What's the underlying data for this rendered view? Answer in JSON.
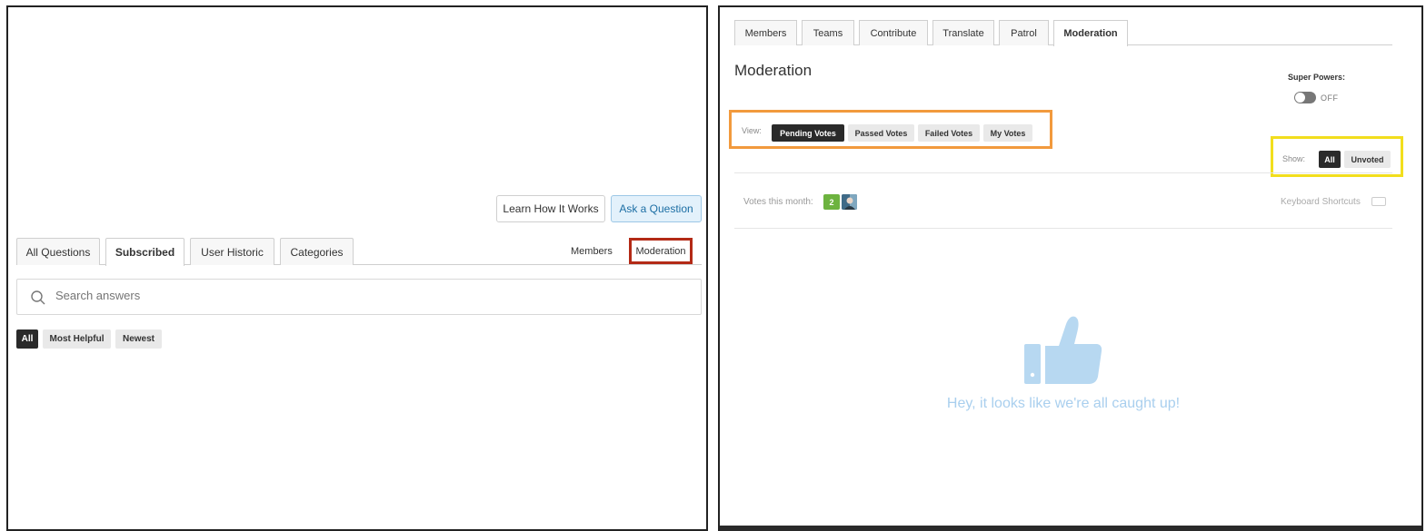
{
  "left": {
    "buttons": {
      "learn": "Learn How It Works",
      "ask": "Ask a Question"
    },
    "tabs": [
      "All Questions",
      "Subscribed",
      "User Historic",
      "Categories"
    ],
    "links": {
      "members": "Members",
      "moderation": "Moderation"
    },
    "search": {
      "placeholder": "Search answers"
    },
    "filters": [
      "All",
      "Most Helpful",
      "Newest"
    ],
    "highlight_color": "#b32a16"
  },
  "right": {
    "tabs": [
      "Members",
      "Teams",
      "Contribute",
      "Translate",
      "Patrol",
      "Moderation"
    ],
    "title": "Moderation",
    "super_powers": {
      "label": "Super Powers:",
      "state": "OFF"
    },
    "view": {
      "label": "View:",
      "options": [
        "Pending Votes",
        "Passed Votes",
        "Failed Votes",
        "My Votes"
      ],
      "highlight_color": "#f29a3d"
    },
    "show": {
      "label": "Show:",
      "options": [
        "All",
        "Unvoted"
      ],
      "highlight_color": "#f2de1d"
    },
    "votes": {
      "label": "Votes this month:",
      "count": "2"
    },
    "keyboard_shortcuts": "Keyboard Shortcuts",
    "empty_message": "Hey, it looks like we're all caught up!",
    "accent": "#a9cfee"
  }
}
